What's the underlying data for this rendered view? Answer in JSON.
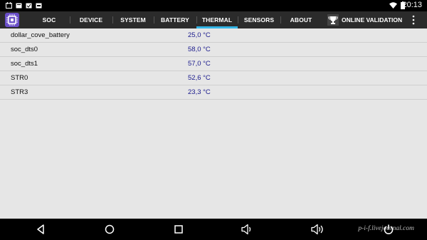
{
  "status_bar": {
    "time": "20:13",
    "icons": [
      "notification-icon",
      "notification-icon",
      "notification-icon",
      "notification-icon",
      "wifi-icon",
      "battery-icon"
    ]
  },
  "app_bar": {
    "tabs": [
      {
        "label": "SOC",
        "active": false
      },
      {
        "label": "DEVICE",
        "active": false
      },
      {
        "label": "SYSTEM",
        "active": false
      },
      {
        "label": "BATTERY",
        "active": false
      },
      {
        "label": "THERMAL",
        "active": true
      },
      {
        "label": "SENSORS",
        "active": false
      },
      {
        "label": "ABOUT",
        "active": false
      }
    ],
    "online_validation": "ONLINE VALIDATION",
    "accent_color": "#33b5e5"
  },
  "thermal": {
    "rows": [
      {
        "name": "dollar_cove_battery",
        "value": "25,0 °C"
      },
      {
        "name": "soc_dts0",
        "value": "58,0 °C"
      },
      {
        "name": "soc_dts1",
        "value": "57,0 °C"
      },
      {
        "name": "STR0",
        "value": "52,6 °C"
      },
      {
        "name": "STR3",
        "value": "23,3 °C"
      }
    ]
  },
  "nav_bar": {
    "watermark": "p-i-f.livejournal.com"
  }
}
